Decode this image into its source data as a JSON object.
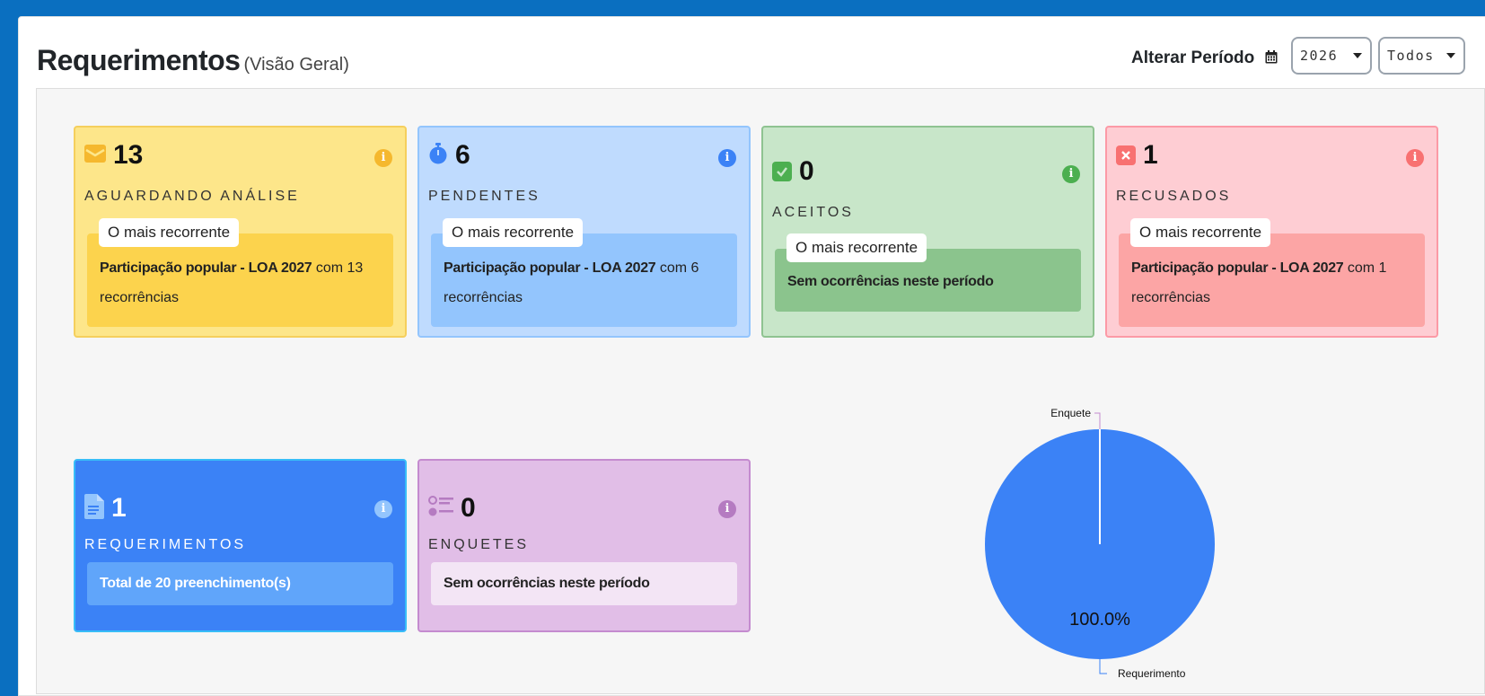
{
  "header": {
    "title": "Requerimentos",
    "subtitle": "(Visão Geral)",
    "period_label": "Alterar Período",
    "year_select": "2026",
    "filter_select": "Todos"
  },
  "cards": {
    "aguardando": {
      "count": "13",
      "label": "AGUARDANDO ANÁLISE",
      "tag": "O mais recorrente",
      "item": "Participação popular - LOA 2027",
      "detail": "com 13 recorrências"
    },
    "pendentes": {
      "count": "6",
      "label": "PENDENTES",
      "tag": "O mais recorrente",
      "item": "Participação popular - LOA 2027",
      "detail": "com 6 recorrências"
    },
    "aceitos": {
      "count": "0",
      "label": "ACEITOS",
      "tag": "O mais recorrente",
      "text": "Sem ocorrências neste período"
    },
    "recusados": {
      "count": "1",
      "label": "RECUSADOS",
      "tag": "O mais recorrente",
      "item": "Participação popular - LOA 2027",
      "detail": "com 1 recorrências"
    },
    "requerimentos": {
      "count": "1",
      "label": "REQUERIMENTOS",
      "text": "Total de 20 preenchimento(s)"
    },
    "enquetes": {
      "count": "0",
      "label": "ENQUETES",
      "text": "Sem ocorrências neste período"
    }
  },
  "colors": {
    "yellow_bg": "#fde68a",
    "blue_bg": "#bfdbfe",
    "green_bg": "#c8e6c9",
    "red_bg": "#fecdd3",
    "requerimentos_bg": "#3b82f6",
    "enquetes_bg": "#e1bee7",
    "pie_fill": "#3b82f6"
  },
  "chart_data": {
    "type": "pie",
    "slices": [
      {
        "label": "Requerimento",
        "value": 100.0,
        "percent_label": "100.0%"
      },
      {
        "label": "Enquete",
        "value": 0.0,
        "percent_label": ""
      }
    ]
  }
}
